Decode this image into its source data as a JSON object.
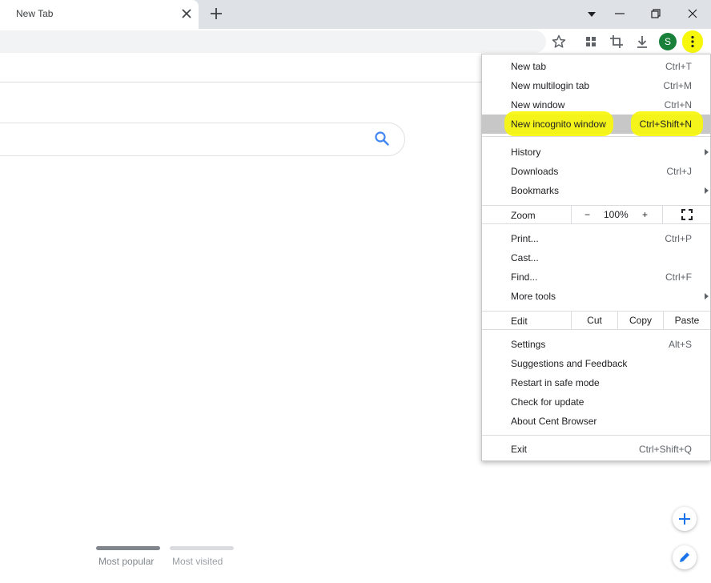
{
  "browser": {
    "tab_title": "New Tab",
    "avatar_letter": "S",
    "accent_color": "#1a73e8",
    "highlight_color": "#f7f70c"
  },
  "menu": {
    "items_top": [
      {
        "label": "New tab",
        "shortcut": "Ctrl+T"
      },
      {
        "label": "New multilogin tab",
        "shortcut": "Ctrl+M"
      },
      {
        "label": "New window",
        "shortcut": "Ctrl+N"
      },
      {
        "label": "New incognito window",
        "shortcut": "Ctrl+Shift+N"
      }
    ],
    "items_nav": [
      {
        "label": "History",
        "shortcut": ""
      },
      {
        "label": "Downloads",
        "shortcut": "Ctrl+J"
      },
      {
        "label": "Bookmarks",
        "shortcut": ""
      }
    ],
    "zoom": {
      "label": "Zoom",
      "minus": "−",
      "value": "100%",
      "plus": "+"
    },
    "items_tools": [
      {
        "label": "Print...",
        "shortcut": "Ctrl+P"
      },
      {
        "label": "Cast...",
        "shortcut": ""
      },
      {
        "label": "Find...",
        "shortcut": "Ctrl+F"
      },
      {
        "label": "More tools",
        "shortcut": ""
      }
    ],
    "edit": {
      "label": "Edit",
      "cut": "Cut",
      "copy": "Copy",
      "paste": "Paste"
    },
    "items_settings": [
      {
        "label": "Settings",
        "shortcut": "Alt+S"
      },
      {
        "label": "Suggestions and Feedback",
        "shortcut": ""
      },
      {
        "label": "Restart in safe mode",
        "shortcut": ""
      },
      {
        "label": "Check for update",
        "shortcut": ""
      },
      {
        "label": "About Cent Browser",
        "shortcut": ""
      }
    ],
    "exit": {
      "label": "Exit",
      "shortcut": "Ctrl+Shift+Q"
    }
  },
  "tiles": {
    "most_popular": "Most popular",
    "most_visited": "Most visited"
  }
}
